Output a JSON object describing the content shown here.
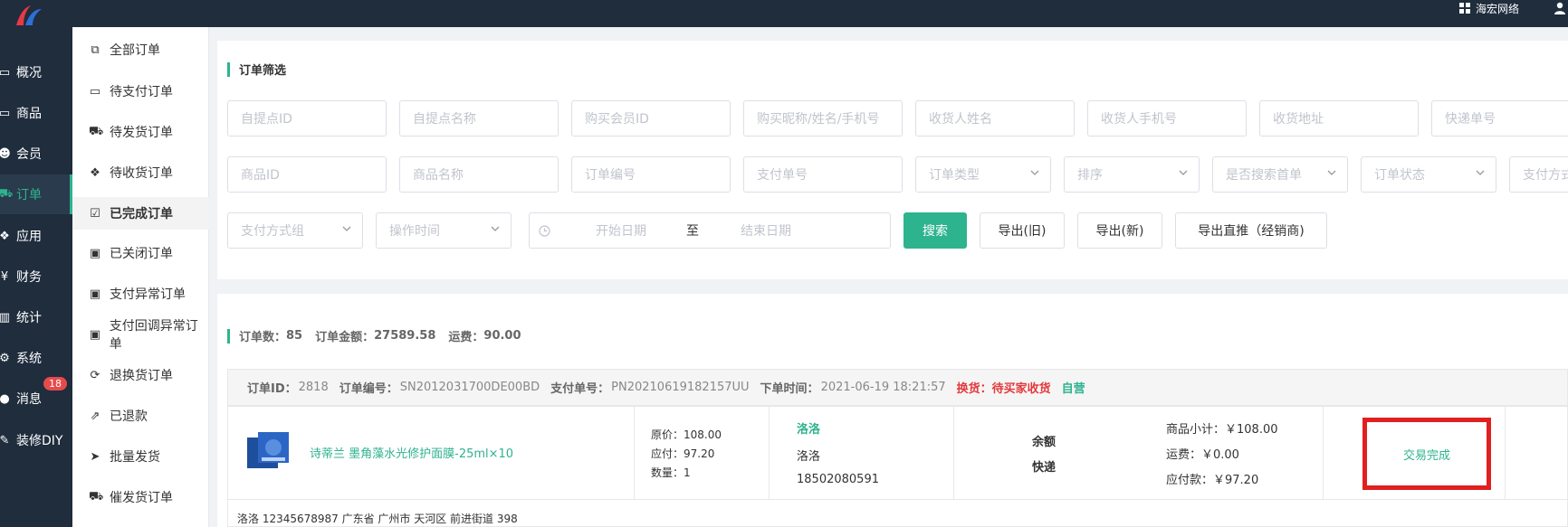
{
  "topbar": {
    "company": "海宏网络"
  },
  "mainnav": [
    {
      "label": "概况",
      "icon": "dashboard-icon"
    },
    {
      "label": "商品",
      "icon": "goods-icon"
    },
    {
      "label": "会员",
      "icon": "members-icon"
    },
    {
      "label": "订单",
      "icon": "cart-icon",
      "active": true
    },
    {
      "label": "应用",
      "icon": "apps-icon"
    },
    {
      "label": "财务",
      "icon": "yen-icon"
    },
    {
      "label": "统计",
      "icon": "bar-chart-icon"
    },
    {
      "label": "系统",
      "icon": "system-icon"
    },
    {
      "label": "消息",
      "icon": "message-icon",
      "badge": "18"
    },
    {
      "label": "装修DIY",
      "icon": "brush-icon"
    }
  ],
  "subnav": [
    {
      "label": "全部订单",
      "icon": "copy-icon"
    },
    {
      "label": "待支付订单",
      "icon": "credit-card-icon"
    },
    {
      "label": "待发货订单",
      "icon": "truck-icon"
    },
    {
      "label": "待收货订单",
      "icon": "dropbox-icon"
    },
    {
      "label": "已完成订单",
      "icon": "check-square-icon",
      "active": true
    },
    {
      "label": "已关闭订单",
      "icon": "receipt-icon"
    },
    {
      "label": "支付异常订单",
      "icon": "receipt-icon"
    },
    {
      "label": "支付回调异常订单",
      "icon": "receipt-icon"
    },
    {
      "label": "退换货订单",
      "icon": "refresh-icon"
    },
    {
      "label": "已退款",
      "icon": "share-square-icon"
    },
    {
      "label": "批量发货",
      "icon": "send-icon"
    },
    {
      "label": "催发货订单",
      "icon": "truck-icon"
    }
  ],
  "filter": {
    "title": "订单筛选",
    "row1": [
      "自提点ID",
      "自提点名称",
      "购买会员ID",
      "购买昵称/姓名/手机号",
      "收货人姓名",
      "收货人手机号",
      "收货地址",
      "快递单号"
    ],
    "row2_inputs": [
      "商品ID",
      "商品名称",
      "订单编号",
      "支付单号"
    ],
    "row2_selects": [
      "订单类型",
      "排序",
      "是否搜索首单",
      "订单状态"
    ],
    "row2_trailing": "支付方式",
    "row3_selects": [
      "支付方式组",
      "操作时间"
    ],
    "date_start": "开始日期",
    "date_sep": "至",
    "date_end": "结束日期",
    "search_btn": "搜索",
    "export_old_btn": "导出(旧)",
    "export_new_btn": "导出(新)",
    "export_direct_btn": "导出直推（经销商)"
  },
  "summary": {
    "count_label": "订单数：",
    "count_value": "85",
    "amount_label": "订单金额：",
    "amount_value": "27589.58",
    "freight_label": "运费：",
    "freight_value": "90.00"
  },
  "order": {
    "id_label": "订单ID：",
    "id_value": "2818",
    "no_label": "订单编号：",
    "no_value": "SN2012031700DE00BD",
    "pay_label": "支付单号：",
    "pay_value": "PN20210619182157UU",
    "time_label": "下单时间：",
    "time_value": "2021-06-19 18:21:57",
    "exchange_status": "换货：待买家收货",
    "self_tag": "自营",
    "product_name": "诗蒂兰 墨角藻水光修护面膜-25ml×10",
    "original_price": "原价：108.00",
    "payable": "应付：97.20",
    "quantity": "数量：1",
    "buyer_link": "洛洛",
    "buyer_name": "洛洛",
    "buyer_phone": "18502080591",
    "pay_method": "余额",
    "ship_method": "快递",
    "subtotal": "商品小计：￥108.00",
    "freight": "运费：￥0.00",
    "paid": "应付款：￥97.20",
    "status": "交易完成",
    "address": "洛洛   12345678987   广东省 广州市 天河区 前进街道 398"
  },
  "colors": {
    "accent": "#2eb38f",
    "sidebar": "#1f2d3d",
    "alert": "#e02020"
  }
}
